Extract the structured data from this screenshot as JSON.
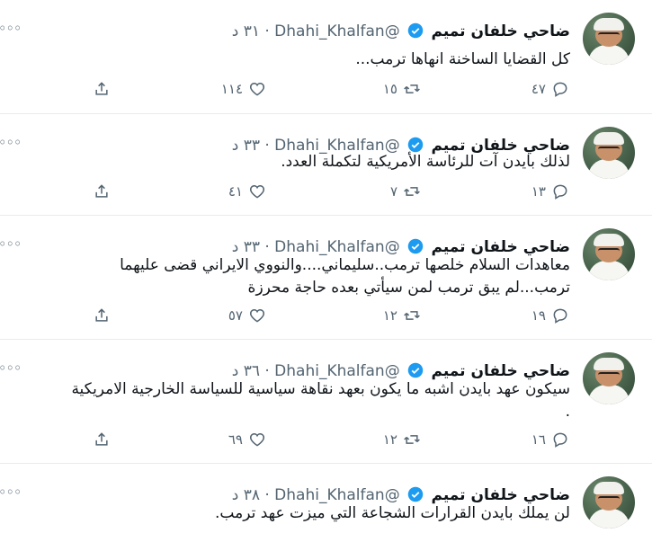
{
  "author": {
    "name": "ضاحي خلفان تميم",
    "handle": "@Dhahi_Khalfan",
    "dot": "·"
  },
  "more_label": "◦◦◦",
  "tweets": [
    {
      "time": "٣١ د",
      "lines": [
        "كل القضايا الساخنة انهاها  ترمب..."
      ],
      "replies": "٤٧",
      "retweets": "١٥",
      "likes": "١١٤"
    },
    {
      "time": "٣٣ د",
      "lines": [
        "لذلك بايدن آت للرئاسة الأمريكية  لتكملة العدد."
      ],
      "replies": "١٣",
      "retweets": "٧",
      "likes": "٤١"
    },
    {
      "time": "٣٣ د",
      "lines": [
        "معاهدات السلام خلصها ترمب..سليماني....والنووي الايراني قضى عليهما",
        "ترمب...لم يبق ترمب لمن سيأتي بعده حاجة محرزة"
      ],
      "replies": "١٩",
      "retweets": "١٢",
      "likes": "٥٧"
    },
    {
      "time": "٣٦ د",
      "lines": [
        "سيكون عهد بايدن اشبه ما يكون  بعهد نقاهة سياسية للسياسة الخارجية الامريكية",
        "."
      ],
      "replies": "١٦",
      "retweets": "١٢",
      "likes": "٦٩"
    },
    {
      "time": "٣٨ د",
      "lines": [
        "لن يملك بايدن القرارات الشجاعة التي ميزت عهد ترمب."
      ],
      "replies": "",
      "retweets": "",
      "likes": ""
    }
  ],
  "colors": {
    "text": "#0f1419",
    "secondary": "#536471",
    "verified": "#1d9bf0",
    "divider": "#e6ecf0"
  }
}
